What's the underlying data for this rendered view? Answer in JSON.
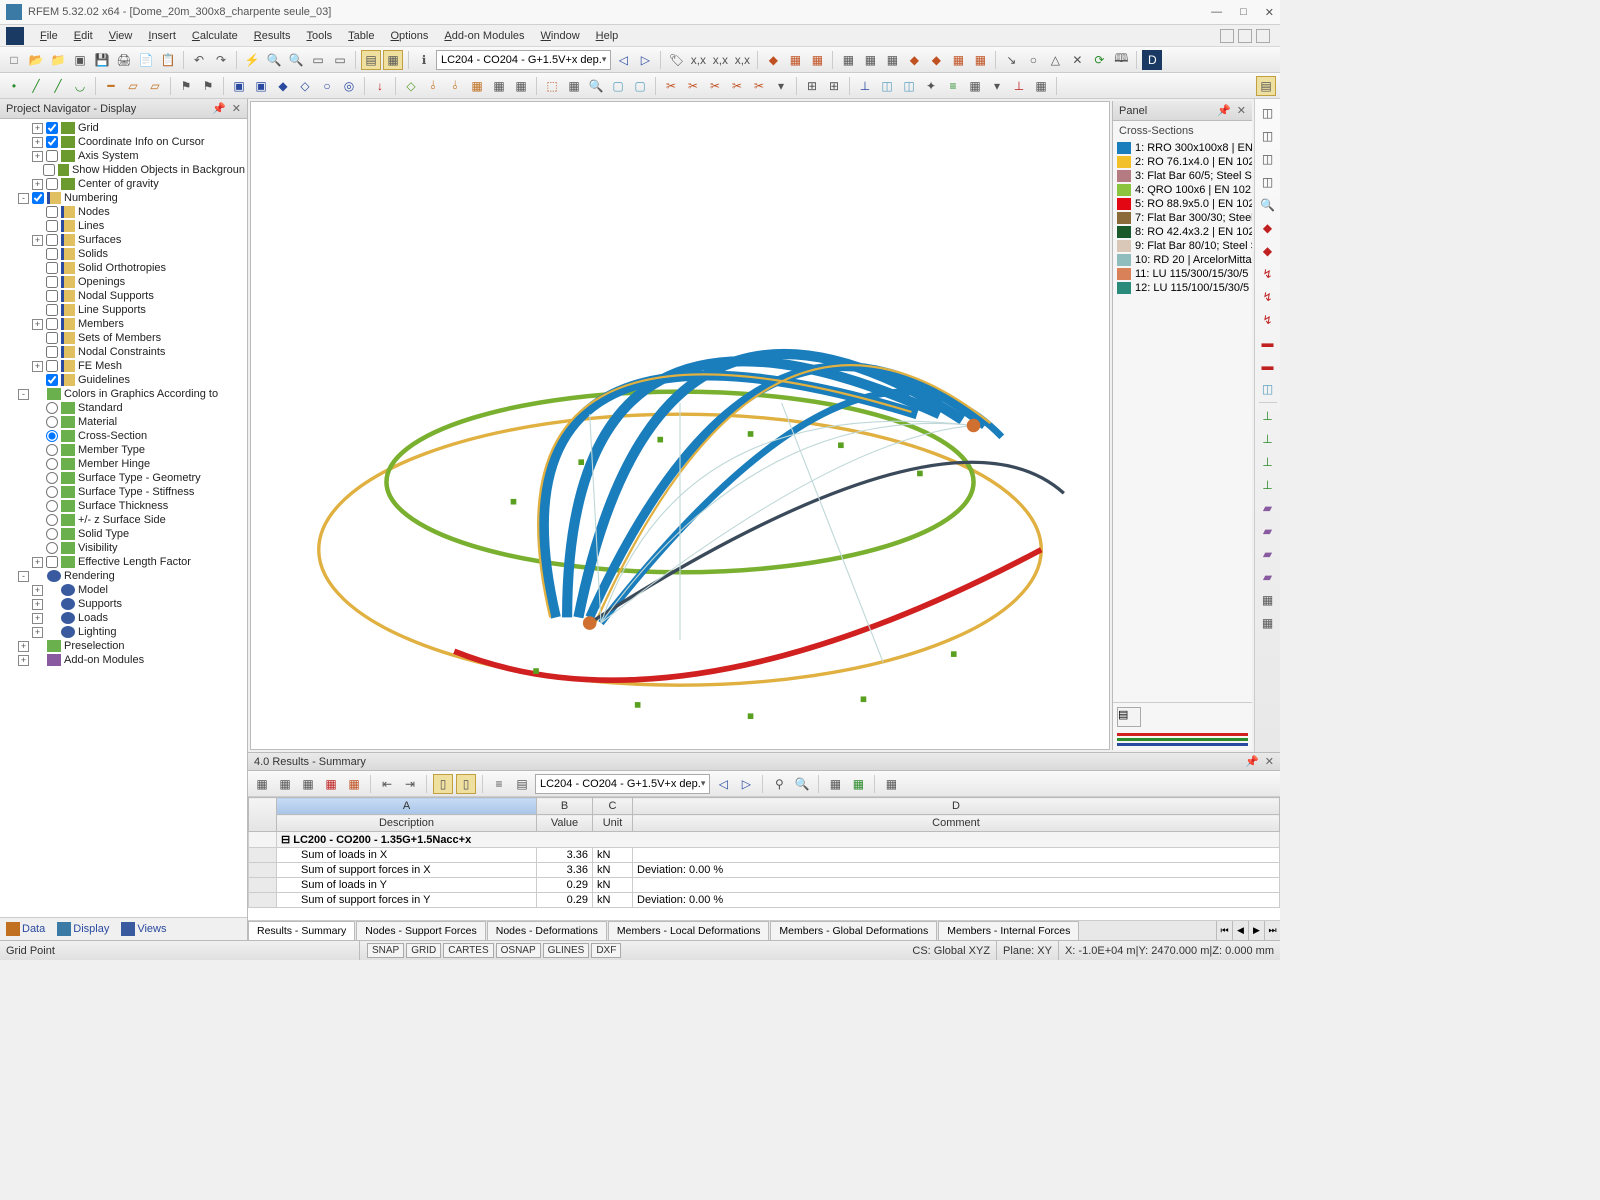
{
  "app": {
    "title": "RFEM 5.32.02 x64 - [Dome_20m_300x8_charpente seule_03]"
  },
  "menu": {
    "items": [
      "File",
      "Edit",
      "View",
      "Insert",
      "Calculate",
      "Results",
      "Tools",
      "Table",
      "Options",
      "Add-on Modules",
      "Window",
      "Help"
    ]
  },
  "loadcase_combo": "LC204 - CO204 - G+1.5V+x dep.",
  "navigator": {
    "title": "Project Navigator - Display",
    "nodes": [
      {
        "lvl": 2,
        "exp": "+",
        "chk": true,
        "ic": "green",
        "label": "Grid"
      },
      {
        "lvl": 2,
        "exp": "+",
        "chk": true,
        "ic": "green",
        "label": "Coordinate Info on Cursor"
      },
      {
        "lvl": 2,
        "exp": "+",
        "chk": false,
        "ic": "green",
        "label": "Axis System"
      },
      {
        "lvl": 2,
        "exp": "",
        "chk": false,
        "ic": "green",
        "label": "Show Hidden Objects in Backgroun"
      },
      {
        "lvl": 2,
        "exp": "+",
        "chk": false,
        "ic": "green",
        "label": "Center of gravity"
      },
      {
        "lvl": 1,
        "exp": "-",
        "chk": true,
        "ic": "num",
        "label": "Numbering"
      },
      {
        "lvl": 2,
        "exp": "",
        "chk": false,
        "ic": "num",
        "label": "Nodes"
      },
      {
        "lvl": 2,
        "exp": "",
        "chk": false,
        "ic": "num",
        "label": "Lines"
      },
      {
        "lvl": 2,
        "exp": "+",
        "chk": false,
        "ic": "num",
        "label": "Surfaces"
      },
      {
        "lvl": 2,
        "exp": "",
        "chk": false,
        "ic": "num",
        "label": "Solids"
      },
      {
        "lvl": 2,
        "exp": "",
        "chk": false,
        "ic": "num",
        "label": "Solid Orthotropies"
      },
      {
        "lvl": 2,
        "exp": "",
        "chk": false,
        "ic": "num",
        "label": "Openings"
      },
      {
        "lvl": 2,
        "exp": "",
        "chk": false,
        "ic": "num",
        "label": "Nodal Supports"
      },
      {
        "lvl": 2,
        "exp": "",
        "chk": false,
        "ic": "num",
        "label": "Line Supports"
      },
      {
        "lvl": 2,
        "exp": "+",
        "chk": false,
        "ic": "num",
        "label": "Members"
      },
      {
        "lvl": 2,
        "exp": "",
        "chk": false,
        "ic": "num",
        "label": "Sets of Members"
      },
      {
        "lvl": 2,
        "exp": "",
        "chk": false,
        "ic": "num",
        "label": "Nodal Constraints"
      },
      {
        "lvl": 2,
        "exp": "+",
        "chk": false,
        "ic": "num",
        "label": "FE Mesh"
      },
      {
        "lvl": 2,
        "exp": "",
        "chk": true,
        "ic": "num",
        "label": "Guidelines"
      },
      {
        "lvl": 1,
        "exp": "-",
        "chk": null,
        "ic": "layers",
        "label": "Colors in Graphics According to"
      },
      {
        "lvl": 2,
        "exp": "",
        "rad": false,
        "ic": "layers",
        "label": "Standard"
      },
      {
        "lvl": 2,
        "exp": "",
        "rad": false,
        "ic": "layers",
        "label": "Material"
      },
      {
        "lvl": 2,
        "exp": "",
        "rad": true,
        "ic": "layers",
        "label": "Cross-Section"
      },
      {
        "lvl": 2,
        "exp": "",
        "rad": false,
        "ic": "layers",
        "label": "Member Type"
      },
      {
        "lvl": 2,
        "exp": "",
        "rad": false,
        "ic": "layers",
        "label": "Member Hinge"
      },
      {
        "lvl": 2,
        "exp": "",
        "rad": false,
        "ic": "layers",
        "label": "Surface Type - Geometry"
      },
      {
        "lvl": 2,
        "exp": "",
        "rad": false,
        "ic": "layers",
        "label": "Surface Type - Stiffness"
      },
      {
        "lvl": 2,
        "exp": "",
        "rad": false,
        "ic": "layers",
        "label": "Surface Thickness"
      },
      {
        "lvl": 2,
        "exp": "",
        "rad": false,
        "ic": "layers",
        "label": "+/- z Surface Side"
      },
      {
        "lvl": 2,
        "exp": "",
        "rad": false,
        "ic": "layers",
        "label": "Solid Type"
      },
      {
        "lvl": 2,
        "exp": "",
        "rad": false,
        "ic": "layers",
        "label": "Visibility"
      },
      {
        "lvl": 2,
        "exp": "+",
        "chk": false,
        "ic": "layers",
        "label": "Effective Length Factor"
      },
      {
        "lvl": 1,
        "exp": "-",
        "chk": null,
        "ic": "render",
        "label": "Rendering"
      },
      {
        "lvl": 2,
        "exp": "+",
        "chk": null,
        "ic": "render",
        "label": "Model"
      },
      {
        "lvl": 2,
        "exp": "+",
        "chk": null,
        "ic": "render",
        "label": "Supports"
      },
      {
        "lvl": 2,
        "exp": "+",
        "chk": null,
        "ic": "render",
        "label": "Loads"
      },
      {
        "lvl": 2,
        "exp": "+",
        "chk": null,
        "ic": "render",
        "label": "Lighting"
      },
      {
        "lvl": 1,
        "exp": "+",
        "chk": null,
        "ic": "layers",
        "label": "Preselection"
      },
      {
        "lvl": 1,
        "exp": "+",
        "chk": null,
        "ic": "purple",
        "label": "Add-on Modules"
      }
    ],
    "footer": {
      "data": "Data",
      "display": "Display",
      "views": "Views"
    }
  },
  "panel": {
    "title": "Panel",
    "section_title": "Cross-Sections",
    "cs": [
      {
        "c": "#1a7dbc",
        "t": "1: RRO 300x100x8 | EN"
      },
      {
        "c": "#f2c028",
        "t": "2: RO 76.1x4.0 | EN 102"
      },
      {
        "c": "#b57b82",
        "t": "3: Flat Bar 60/5; Steel S"
      },
      {
        "c": "#8bc53f",
        "t": "4: QRO 100x6 | EN 1021"
      },
      {
        "c": "#e30613",
        "t": "5: RO 88.9x5.0 | EN 102"
      },
      {
        "c": "#8b6b3a",
        "t": "7: Flat Bar 300/30; Steel"
      },
      {
        "c": "#1a5a2a",
        "t": "8: RO 42.4x3.2 | EN 102"
      },
      {
        "c": "#d9c7b8",
        "t": "9: Flat Bar 80/10; Steel S"
      },
      {
        "c": "#8fbdbd",
        "t": "10: RD 20 | ArcelorMittal"
      },
      {
        "c": "#d9825a",
        "t": "11: LU 115/300/15/30/5"
      },
      {
        "c": "#2a8b7a",
        "t": "12: LU 115/100/15/30/5"
      }
    ]
  },
  "results": {
    "title": "4.0 Results - Summary",
    "combo": "LC204 - CO204 - G+1.5V+x dep.",
    "headers": {
      "letters": [
        "A",
        "B",
        "C",
        "D"
      ],
      "names": [
        "Description",
        "Value",
        "Unit",
        "Comment"
      ]
    },
    "group": "LC200 - CO200 - 1.35G+1.5Nacc+x",
    "rows": [
      {
        "d": "Sum of loads in X",
        "v": "3.36",
        "u": "kN",
        "c": ""
      },
      {
        "d": "Sum of support forces in X",
        "v": "3.36",
        "u": "kN",
        "c": "Deviation:  0.00 %"
      },
      {
        "d": "Sum of loads in Y",
        "v": "0.29",
        "u": "kN",
        "c": ""
      },
      {
        "d": "Sum of support forces in Y",
        "v": "0.29",
        "u": "kN",
        "c": "Deviation:  0.00 %"
      }
    ],
    "tabs": [
      "Results - Summary",
      "Nodes - Support Forces",
      "Nodes - Deformations",
      "Members - Local Deformations",
      "Members - Global Deformations",
      "Members - Internal Forces"
    ]
  },
  "status": {
    "left": "Grid Point",
    "snaps": [
      "SNAP",
      "GRID",
      "CARTES",
      "OSNAP",
      "GLINES",
      "DXF"
    ],
    "cs": "CS: Global XYZ",
    "plane": "Plane: XY",
    "coords": "X: -1.0E+04 m|Y:  2470.000 m|Z:  0.000 mm"
  }
}
